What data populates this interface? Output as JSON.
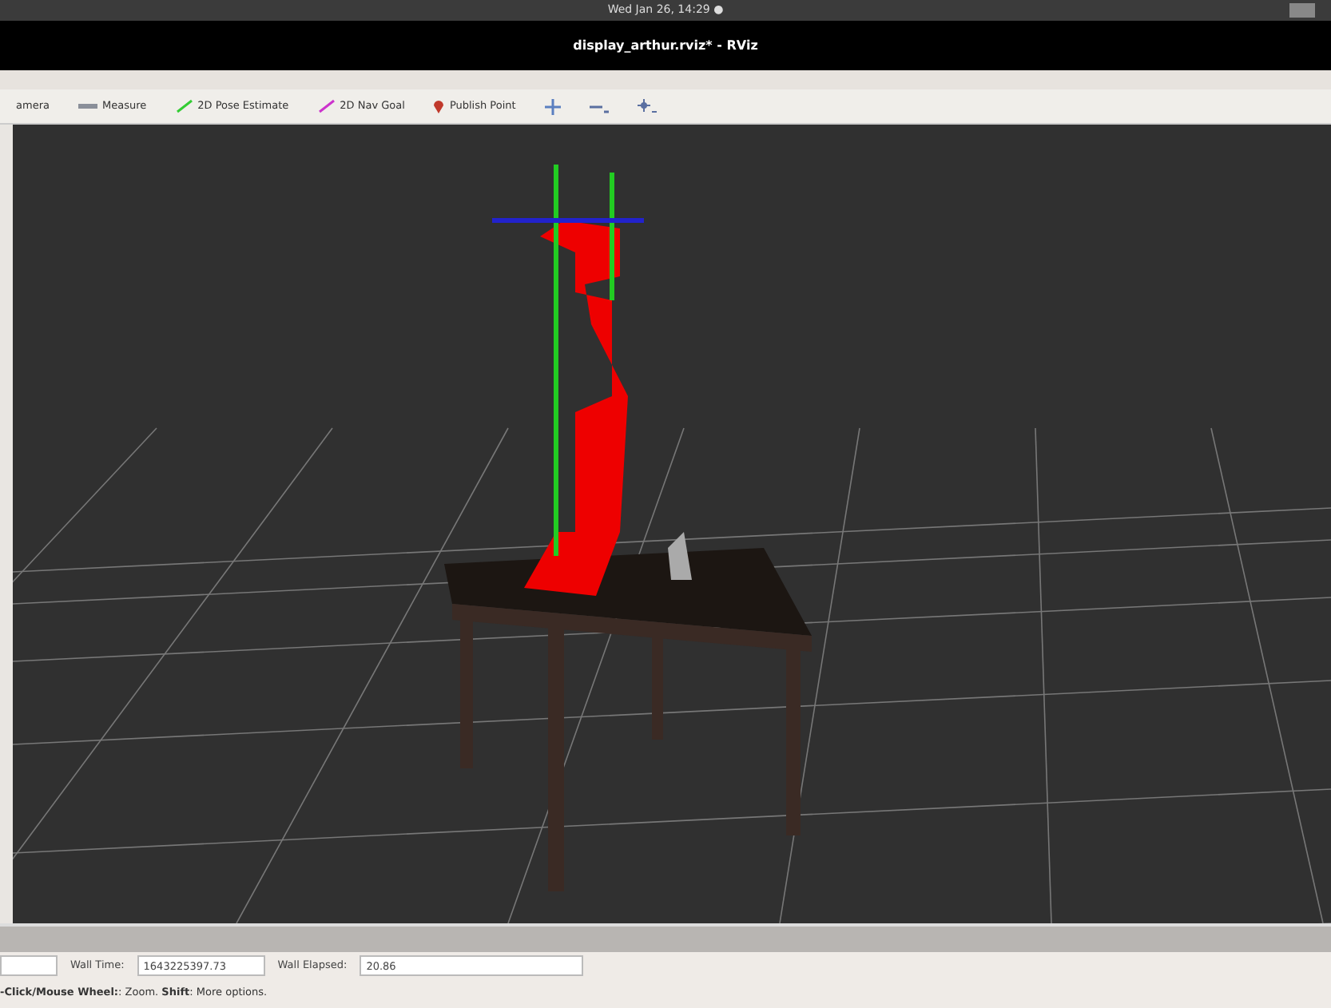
{
  "top_bar": {
    "clock": "Wed Jan 26, 14:29 ●"
  },
  "window": {
    "title": "display_arthur.rviz* - RViz"
  },
  "toolbar": [
    {
      "kind": "camera",
      "label": "amera"
    },
    {
      "kind": "measure",
      "label": "Measure"
    },
    {
      "kind": "pose",
      "label": "2D Pose Estimate"
    },
    {
      "kind": "goal",
      "label": "2D Nav Goal"
    },
    {
      "kind": "point",
      "label": "Publish Point"
    },
    {
      "kind": "move"
    },
    {
      "kind": "minus"
    },
    {
      "kind": "focus"
    }
  ],
  "time_panel": {
    "fields": [
      {
        "label": "Wall Time:",
        "value": "1643225397.73"
      },
      {
        "label": "Wall Elapsed:",
        "value": "20.86"
      }
    ]
  },
  "status_bar": "**-Click/Mouse Wheel:**: Zoom. **Shift**: More options."
}
